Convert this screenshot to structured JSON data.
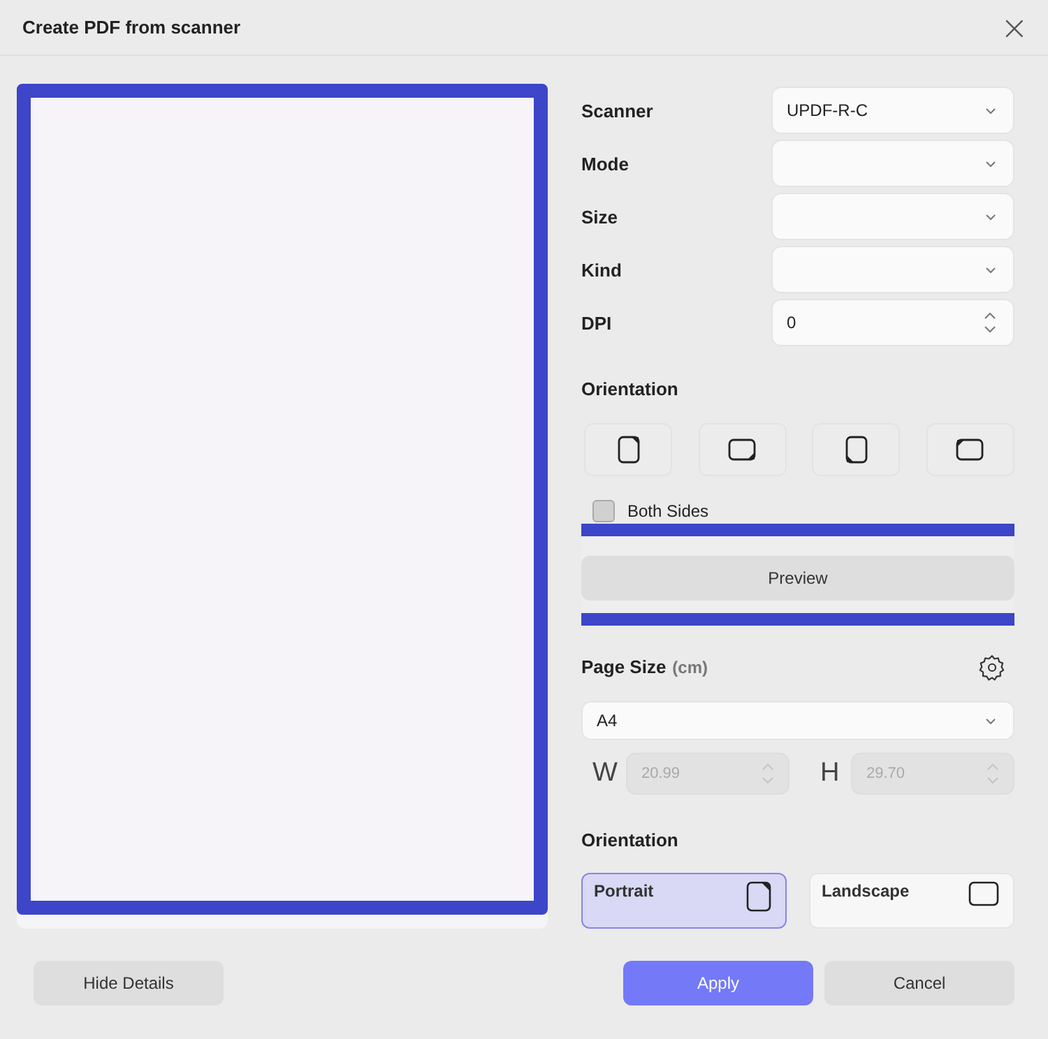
{
  "window": {
    "title": "Create PDF from scanner",
    "close": "×"
  },
  "preview_pane": {
    "highlighted": true
  },
  "settings": [
    {
      "label": "Scanner",
      "kind": "dropdown",
      "value": "UPDF-R-C"
    },
    {
      "label": "Mode",
      "kind": "dropdown"
    },
    {
      "label": "Size",
      "kind": "dropdown"
    },
    {
      "label": "Kind",
      "kind": "dropdown"
    },
    {
      "label": "DPI",
      "kind": "spin",
      "value": "0"
    }
  ],
  "scan_orientation": {
    "label": "Orientation",
    "options": [
      {
        "selected": false
      },
      {
        "selected": false
      },
      {
        "selected": false
      },
      {
        "selected": false
      }
    ]
  },
  "both_sides": {
    "label": "Both Sides",
    "checked": false
  },
  "preview_button": {
    "label": "Preview",
    "highlighted": true
  },
  "page_size": {
    "label": "Page Size",
    "unit": "(cm)",
    "value": "A4",
    "width": {
      "label": "W",
      "value": "20.99",
      "disabled": true
    },
    "height": {
      "label": "H",
      "value": "29.70",
      "disabled": true
    }
  },
  "page_orientation": {
    "label": "Orientation",
    "options": [
      {
        "label": "Portrait",
        "selected": true
      },
      {
        "label": "Landscape",
        "selected": false
      }
    ]
  },
  "footer": {
    "hide_details": "Hide Details",
    "apply": "Apply",
    "cancel": "Cancel"
  }
}
